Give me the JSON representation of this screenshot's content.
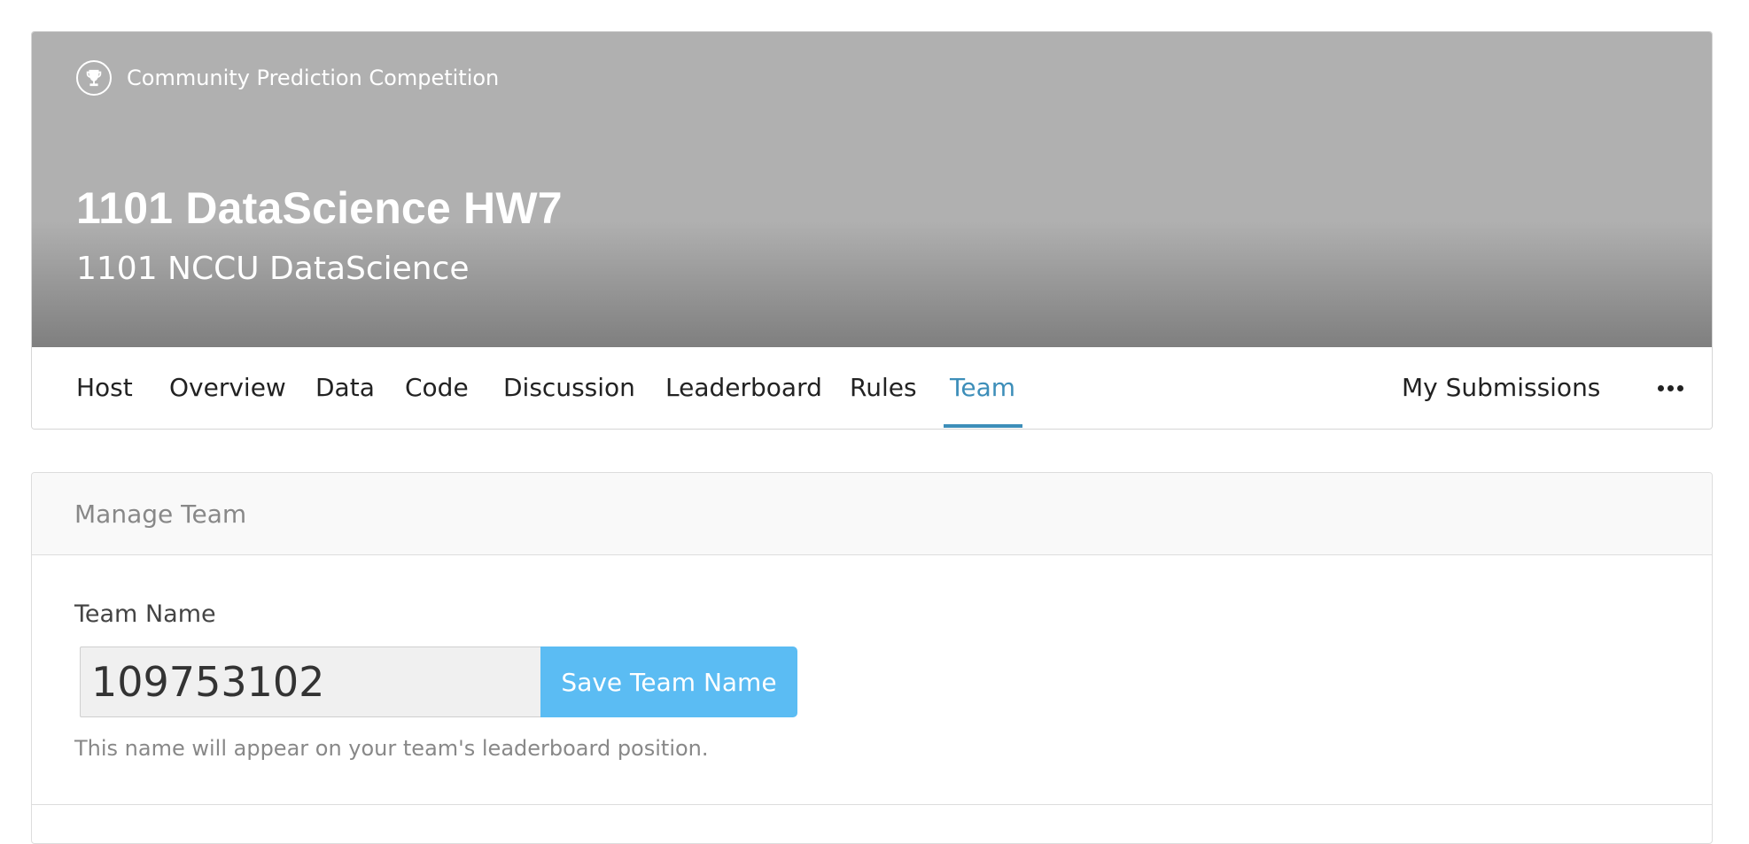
{
  "header": {
    "competition_type": "Community Prediction Competition",
    "competition_type_icon": "trophy-icon",
    "title": "1101 DataScience HW7",
    "subtitle": "1101 NCCU DataScience"
  },
  "tabs": [
    {
      "label": "Host"
    },
    {
      "label": "Overview"
    },
    {
      "label": "Data"
    },
    {
      "label": "Code"
    },
    {
      "label": "Discussion"
    },
    {
      "label": "Leaderboard"
    },
    {
      "label": "Rules"
    },
    {
      "label": "Team"
    }
  ],
  "active_tab": "Team",
  "my_submissions_label": "My Submissions",
  "more_icon": "more-horizontal-icon",
  "manage_team": {
    "title": "Manage Team",
    "team_name_label": "Team Name",
    "team_name_value": "109753102",
    "save_button_label": "Save Team Name",
    "help_text": "This name will appear on your team's leaderboard position."
  },
  "colors": {
    "accent": "#3d8eb9",
    "button": "#5bbcf3",
    "banner": "#b0b0b0"
  }
}
